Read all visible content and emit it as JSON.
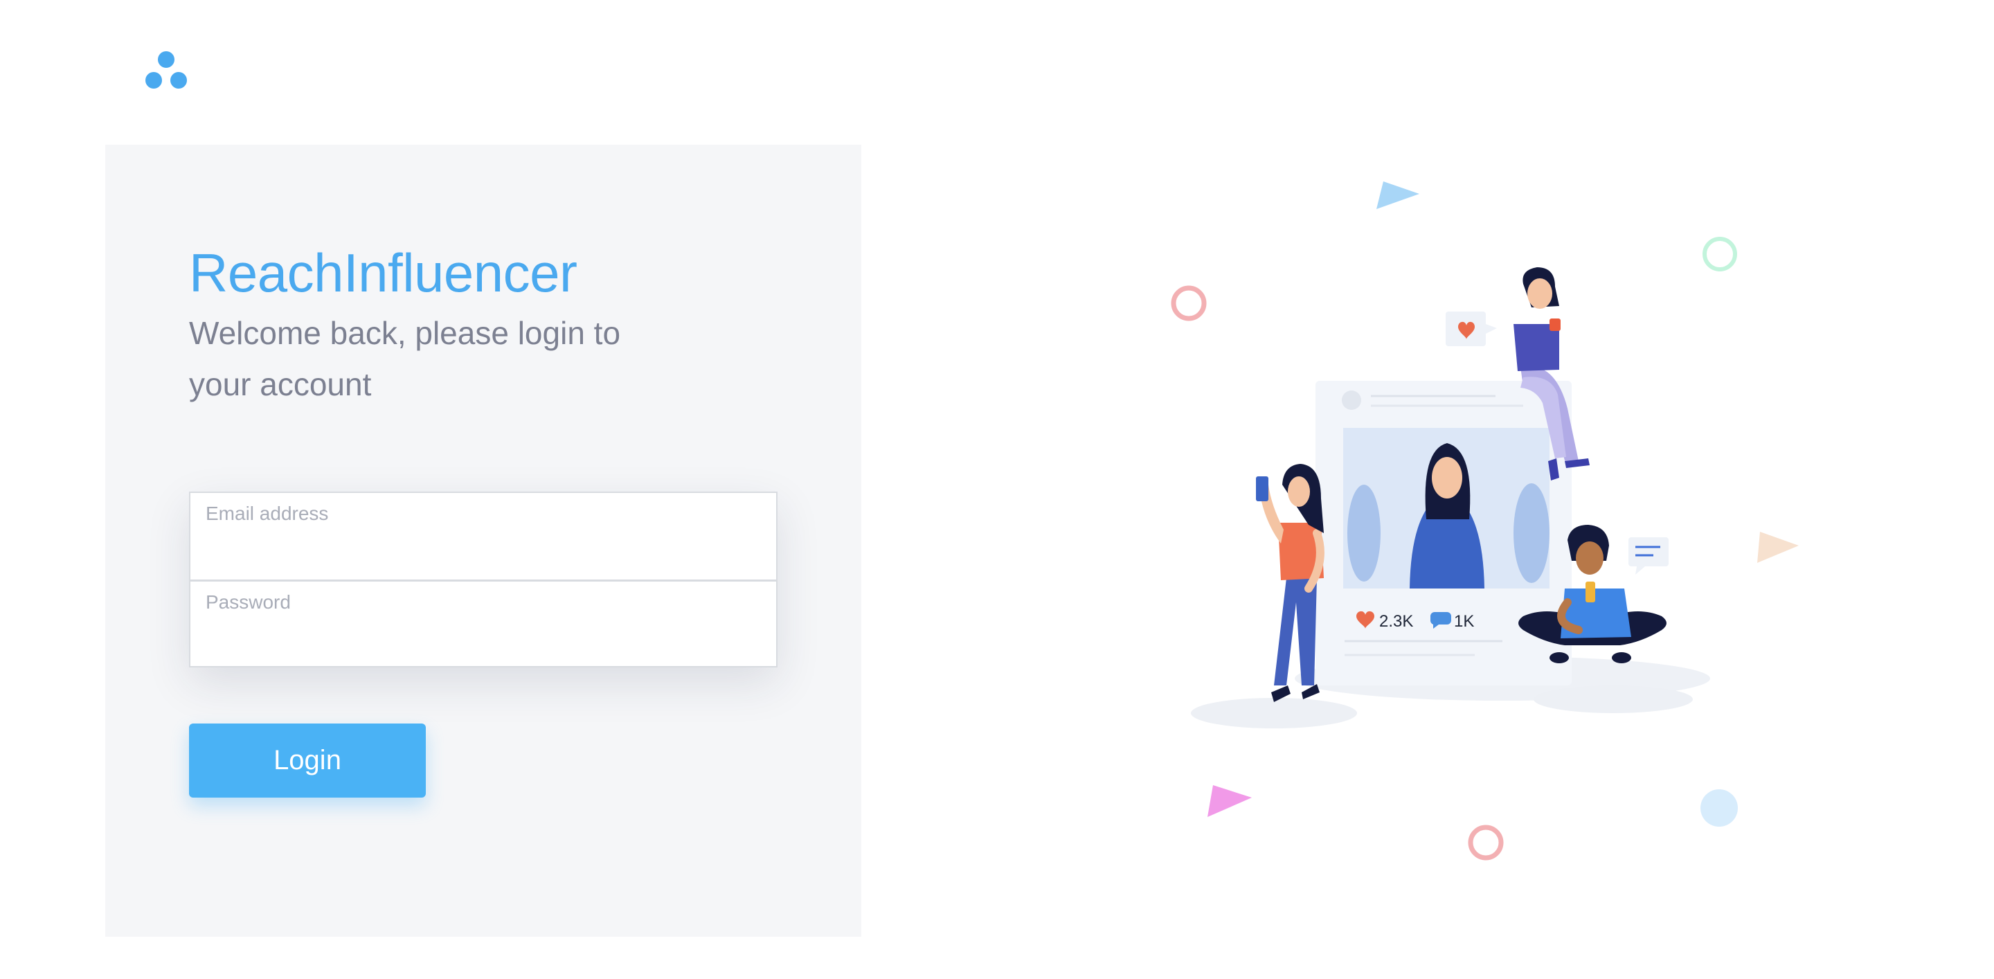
{
  "brand": {
    "name": "ReachInfluencer",
    "tagline": "Welcome back, please login to your account"
  },
  "form": {
    "email_label": "Email address",
    "email_value": "",
    "password_label": "Password",
    "password_value": "",
    "login_label": "Login"
  },
  "illustration": {
    "likes": "2.3K",
    "comments": "1K"
  },
  "colors": {
    "accent": "#4aa9ef",
    "button": "#4ab2f5",
    "panel_bg": "#f5f6f8",
    "text_muted": "#7c8091"
  }
}
